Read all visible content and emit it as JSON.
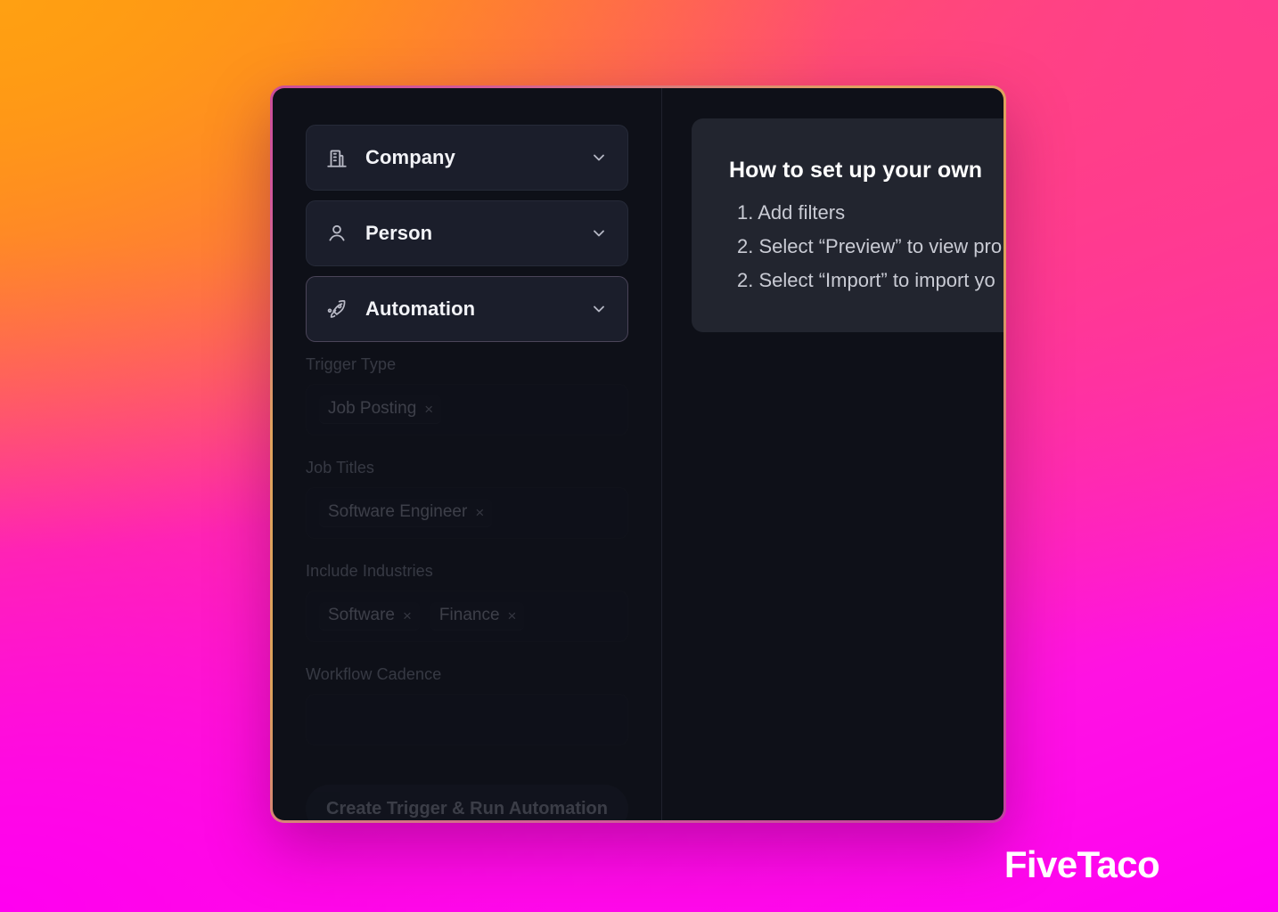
{
  "window": {
    "accent_border_start": "#c94d9a",
    "accent_border_mid": "#e0a35e",
    "accent_border_end": "#c23fa0",
    "surface": "#0e1018"
  },
  "sidebar": {
    "items": [
      {
        "label": "Company",
        "icon": "building-icon",
        "expanded": false,
        "active": false
      },
      {
        "label": "Person",
        "icon": "person-icon",
        "expanded": false,
        "active": false
      },
      {
        "label": "Automation",
        "icon": "rocket-icon",
        "expanded": true,
        "active": true
      }
    ]
  },
  "form": {
    "fields": [
      {
        "label": "Trigger Type",
        "chips": [
          {
            "text": "Job Posting",
            "remove": "×"
          }
        ]
      },
      {
        "label": "Job Titles",
        "chips": [
          {
            "text": "Software Engineer",
            "remove": "×"
          }
        ]
      },
      {
        "label": "Include Industries",
        "chips": [
          {
            "text": "Software",
            "remove": "×"
          },
          {
            "text": "Finance",
            "remove": "×"
          }
        ]
      },
      {
        "label": "Workflow Cadence",
        "chips": []
      }
    ],
    "submit_label": "Create Trigger & Run Automation"
  },
  "howto": {
    "title": "How to set up your own",
    "steps": [
      "1.  Add filters",
      "2.  Select “Preview” to view pro",
      "2.  Select “Import” to import yo"
    ]
  },
  "brand": {
    "name": "FiveTaco"
  }
}
